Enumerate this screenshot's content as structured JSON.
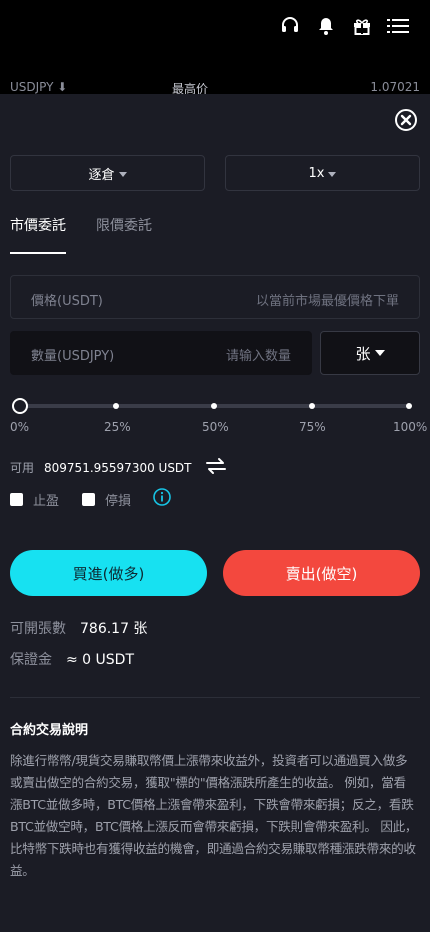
{
  "header": {
    "icons": [
      "headset-icon",
      "bell-icon",
      "gift-icon",
      "menu-icon"
    ]
  },
  "ticker": {
    "symbol": "USDJPY ⬇",
    "label": "最高价",
    "value": "1.07021"
  },
  "order": {
    "margin_mode": "逐倉",
    "leverage": "1x",
    "tabs": [
      "市價委託",
      "限價委託"
    ],
    "active_tab": 0,
    "price_label": "價格(USDT)",
    "price_placeholder": "以當前市場最優價格下單",
    "qty_label": "數量(USDJPY)",
    "qty_placeholder": "请输入数量",
    "unit": "张",
    "slider_ticks": [
      "0%",
      "25%",
      "50%",
      "75%",
      "100%"
    ],
    "slider_value": 0,
    "available_label": "可用",
    "available_value": "809751.95597300 USDT",
    "take_profit_label": "止盈",
    "stop_loss_label": "停損",
    "buy_label": "買進(做多)",
    "sell_label": "賣出(做空)",
    "openable_label": "可開張數",
    "openable_value": "786.17 张",
    "margin_label": "保證金",
    "margin_value": "≈ 0 USDT"
  },
  "description": {
    "title": "合約交易說明",
    "body": "除進行幣幣/現貨交易賺取幣價上漲帶來收益外，投資者可以通過買入做多或賣出做空的合約交易，獲取\"標的\"價格漲跌所產生的收益。 例如，當看漲BTC並做多時，BTC價格上漲會帶來盈利，下跌會帶來虧損；反之，看跌BTC並做空時，BTC價格上漲反而會帶來虧損，下跌則會帶來盈利。 因此，比特幣下跌時也有獲得收益的機會，即通過合約交易賺取幣種漲跌帶來的收益。"
  },
  "colors": {
    "buy": "#17e1f1",
    "sell": "#f3483e",
    "info": "#17c5e6"
  }
}
